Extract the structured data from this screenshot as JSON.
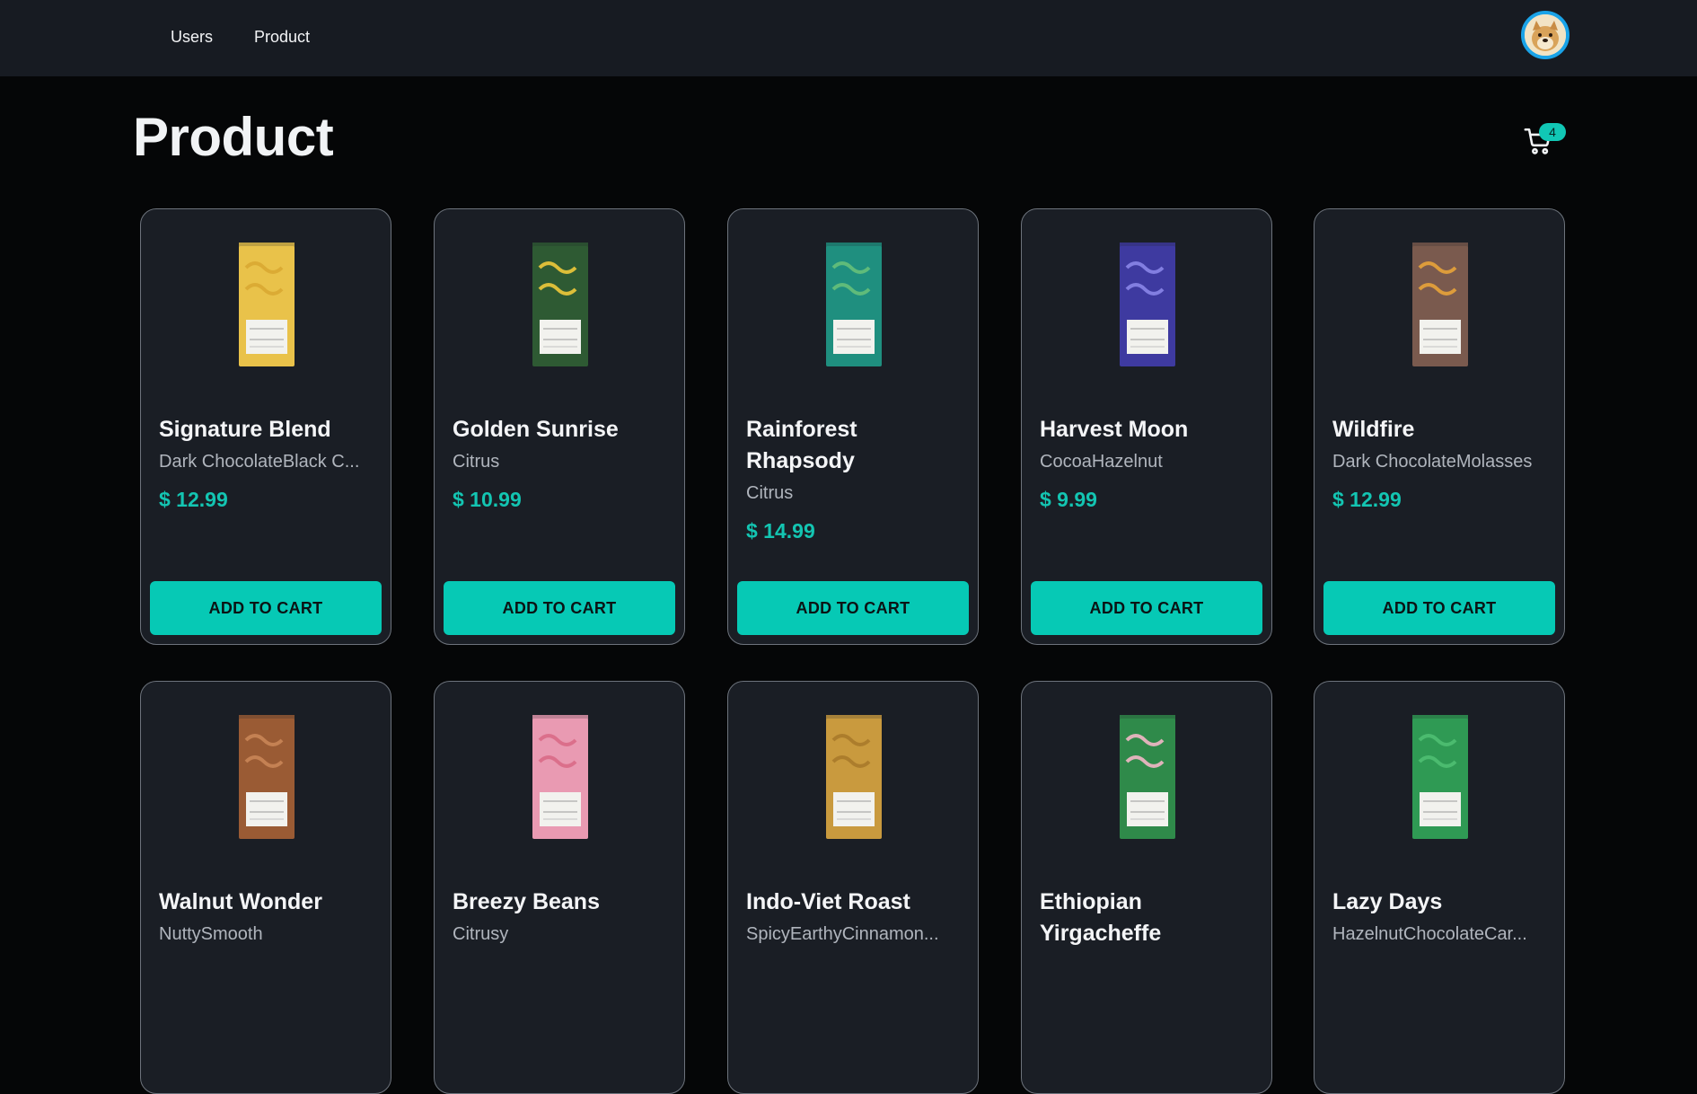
{
  "nav": {
    "links": [
      {
        "label": "Users"
      },
      {
        "label": "Product"
      }
    ]
  },
  "page": {
    "title": "Product"
  },
  "cart": {
    "count": "4"
  },
  "products": [
    {
      "title": "Signature Blend",
      "notes": "Dark ChocolateBlack C...",
      "price": "$ 12.99",
      "button": "ADD TO CART",
      "bag_color": "#e9c24a",
      "accent": "#d9a832"
    },
    {
      "title": "Golden Sunrise",
      "notes": "Citrus",
      "price": "$ 10.99",
      "button": "ADD TO CART",
      "bag_color": "#2e5a33",
      "accent": "#f0c93a"
    },
    {
      "title": "Rainforest Rhapsody",
      "notes": "Citrus",
      "price": "$ 14.99",
      "button": "ADD TO CART",
      "bag_color": "#1f8f7f",
      "accent": "#66c07a"
    },
    {
      "title": "Harvest Moon",
      "notes": "CocoaHazelnut",
      "price": "$ 9.99",
      "button": "ADD TO CART",
      "bag_color": "#3e3aa0",
      "accent": "#8a86e8"
    },
    {
      "title": "Wildfire",
      "notes": "Dark ChocolateMolasses",
      "price": "$ 12.99",
      "button": "ADD TO CART",
      "bag_color": "#7a5a4e",
      "accent": "#e8a33a"
    },
    {
      "title": "Walnut Wonder",
      "notes": "NuttySmooth",
      "price": "",
      "button": "",
      "bag_color": "#9a5b34",
      "accent": "#c98556"
    },
    {
      "title": "Breezy Beans",
      "notes": "Citrusy",
      "price": "",
      "button": "",
      "bag_color": "#e99ab2",
      "accent": "#d96a86"
    },
    {
      "title": "Indo-Viet Roast",
      "notes": "SpicyEarthyCinnamon...",
      "price": "",
      "button": "",
      "bag_color": "#c99a3e",
      "accent": "#a97a2a"
    },
    {
      "title": "Ethiopian Yirgacheffe",
      "notes": "",
      "price": "",
      "button": "",
      "bag_color": "#2f8a4a",
      "accent": "#f3b7c6"
    },
    {
      "title": "Lazy Days",
      "notes": "HazelnutChocolateCar...",
      "price": "",
      "button": "",
      "bag_color": "#2f9a54",
      "accent": "#4fbf72"
    }
  ]
}
